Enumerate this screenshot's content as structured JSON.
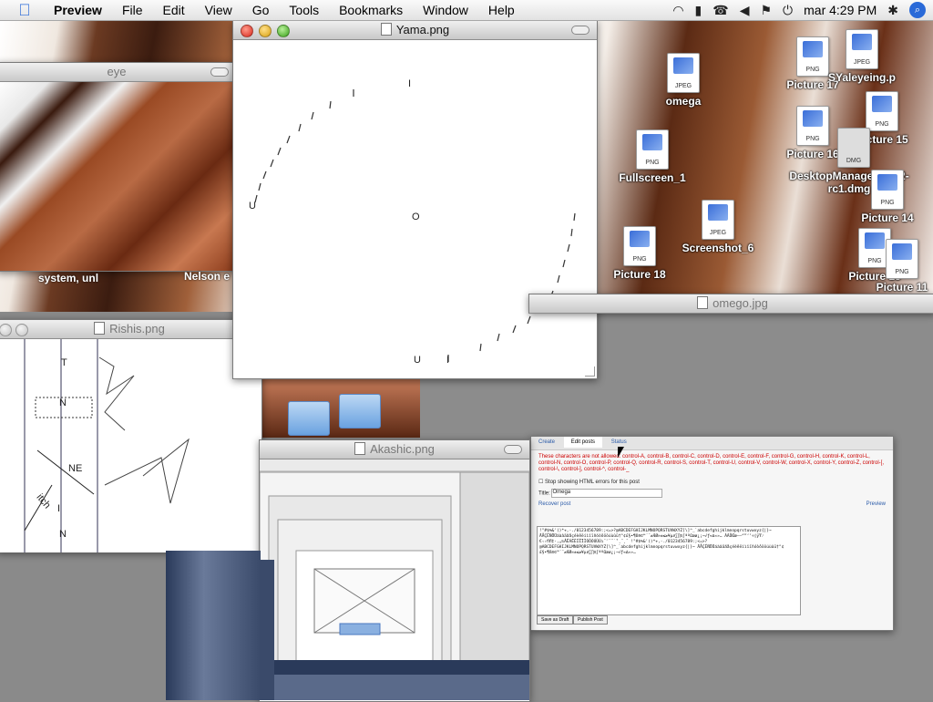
{
  "menubar": {
    "app": "Preview",
    "items": [
      "File",
      "Edit",
      "View",
      "Go",
      "Tools",
      "Bookmarks",
      "Window",
      "Help"
    ],
    "clock": "mar 4:29 PM",
    "status_icons": [
      "wifi-icon",
      "battery-icon",
      "phone-icon",
      "volume-icon",
      "flag-icon",
      "power-icon",
      "clock",
      "bluetooth-icon",
      "spotlight-icon"
    ]
  },
  "windows": {
    "eye": {
      "title": "eye"
    },
    "yama": {
      "title": "Yama.png",
      "glyphs": [
        "I",
        "U",
        "O",
        "U",
        "I"
      ]
    },
    "rishis": {
      "title": "Rishis.png",
      "labels": [
        "T",
        "N",
        "NE",
        "itch",
        "I",
        "N"
      ]
    },
    "akashic": {
      "title": "Akashic.png"
    },
    "omega": {
      "title": "omego.jpg",
      "tabs": [
        "Create",
        "Edit posts",
        "Status"
      ],
      "warning": "These characters are not allowed: control-A, control-B, control-C, control-D, control-E, control-F, control-G, control-H, control-K, control-L, control-N, control-O, control-P, control-Q, control-R, control-S, control-T, control-U, control-V, control-W, control-X, control-Y, control-Z, control-[, control-\\, control-], control-^, control-_",
      "checkbox_label": "Stop showing HTML errors for this post",
      "title_label": "Title:",
      "title_value": "Omega",
      "preview_link": "Preview",
      "recover_label": "Recover post",
      "save_draft": "Save as Draft",
      "publish": "Publish Post"
    }
  },
  "desktop_icons": [
    {
      "label": "omega",
      "kind": "JPEG"
    },
    {
      "label": "Fullscreen_1",
      "kind": "PNG"
    },
    {
      "label": "Screenshot_6",
      "kind": "JPEG"
    },
    {
      "label": "Picture 18",
      "kind": "PNG"
    },
    {
      "label": "Picture 17",
      "kind": "PNG"
    },
    {
      "label": "SYaleyeing.p",
      "kind": "JPEG"
    },
    {
      "label": "Picture 15",
      "kind": "PNG"
    },
    {
      "label": "Picture 16",
      "kind": "PNG"
    },
    {
      "label": "DesktopManager-0.5.2-rc1.dmg",
      "kind": "DMG"
    },
    {
      "label": "Picture 14",
      "kind": "PNG"
    },
    {
      "label": "Picture 13",
      "kind": "PNG"
    },
    {
      "label": "Picture 11",
      "kind": "PNG"
    }
  ],
  "desktop_text": {
    "left1": "system, unl",
    "left2": "Nelson e"
  },
  "colors": {
    "accent": "#2a6ad8",
    "warn": "#cc0000"
  }
}
